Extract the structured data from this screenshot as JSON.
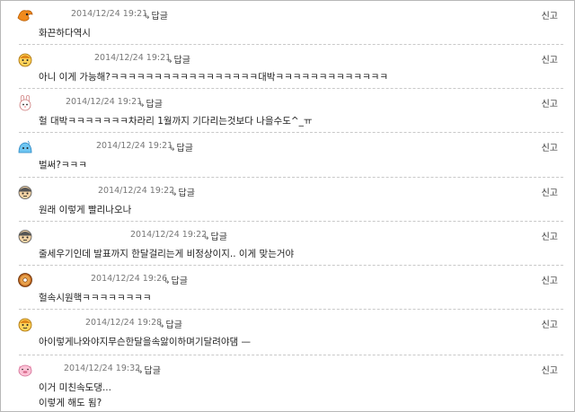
{
  "ui": {
    "reply_label": "답글",
    "report_label": "신고",
    "reply_arrow": "↳"
  },
  "comments": [
    {
      "avatar": "orange-phoenix-icon",
      "date": "2014/12/24 19:21",
      "lines": [
        "화끈하다역시"
      ]
    },
    {
      "avatar": "yellow-face-icon",
      "date": "2014/12/24 19:21",
      "lines": [
        "아니 이게 가능해?ㅋㅋㅋㅋㅋㅋㅋㅋㅋㅋㅋㅋㅋㅋㅋㅋㅋ대박ㅋㅋㅋㅋㅋㅋㅋㅋㅋㅋㅋㅋㅋ"
      ]
    },
    {
      "avatar": "white-rabbit-icon",
      "date": "2014/12/24 19:21",
      "lines": [
        "헐 대박ㅋㅋㅋㅋㅋㅋㅋ차라리 1월까지 기다리는것보다 나을수도^_ㅠ"
      ]
    },
    {
      "avatar": "blue-slime-icon",
      "date": "2014/12/24 19:21",
      "lines": [
        "벌써?ㅋㅋㅋ"
      ]
    },
    {
      "avatar": "ninja-face-icon",
      "date": "2014/12/24 19:22",
      "lines": [
        "원래 이렇게 빨리나오나"
      ]
    },
    {
      "avatar": "ninja-face-icon",
      "date": "2014/12/24 19:22",
      "lines": [
        "줄세우기인데 발표까지 한달걸리는게 비정상이지.. 이게 맞는거야"
      ]
    },
    {
      "avatar": "donut-icon",
      "date": "2014/12/24 19:26",
      "lines": [
        "헐속시원핵ㅋㅋㅋㅋㅋㅋㅋㅋ"
      ]
    },
    {
      "avatar": "yellow-face-icon",
      "date": "2014/12/24 19:28",
      "lines": [
        "아이렇게나와야지무슨한달을속앓이하며기달려야댐 —"
      ]
    },
    {
      "avatar": "pink-pig-icon",
      "date": "2014/12/24 19:32",
      "lines": [
        "이거 미친속도댕...",
        "이렇게 해도 됨?"
      ]
    }
  ]
}
